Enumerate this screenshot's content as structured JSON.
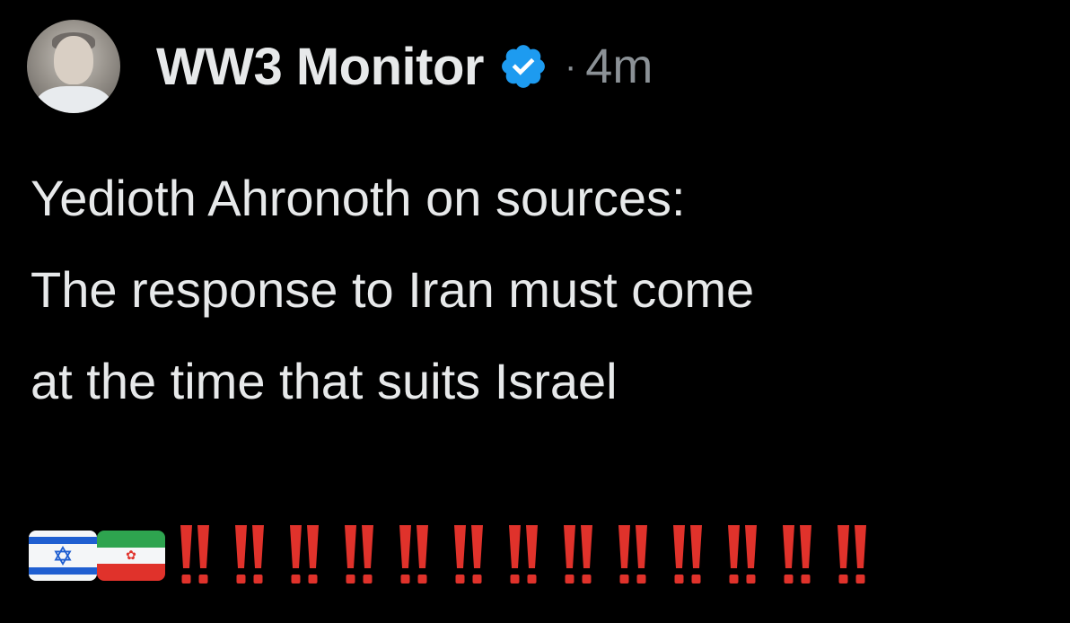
{
  "post": {
    "author": {
      "name": "WW3 Monitor",
      "verified": true,
      "avatar_icon": "profile-photo"
    },
    "separator": "·",
    "timestamp": "4m",
    "text_lines": [
      "Yedioth Ahronoth on sources:",
      "The response to Iran must come",
      "at the time that suits Israel"
    ],
    "emoji": {
      "flags": [
        "flag-israel-icon",
        "flag-iran-icon"
      ],
      "double_exclamation_count": 13
    }
  },
  "colors": {
    "background": "#000000",
    "text_primary": "#e7e9ea",
    "text_secondary": "#8b9196",
    "verified_blue": "#1d9bf0",
    "exclamation_red": "#e0322b"
  }
}
